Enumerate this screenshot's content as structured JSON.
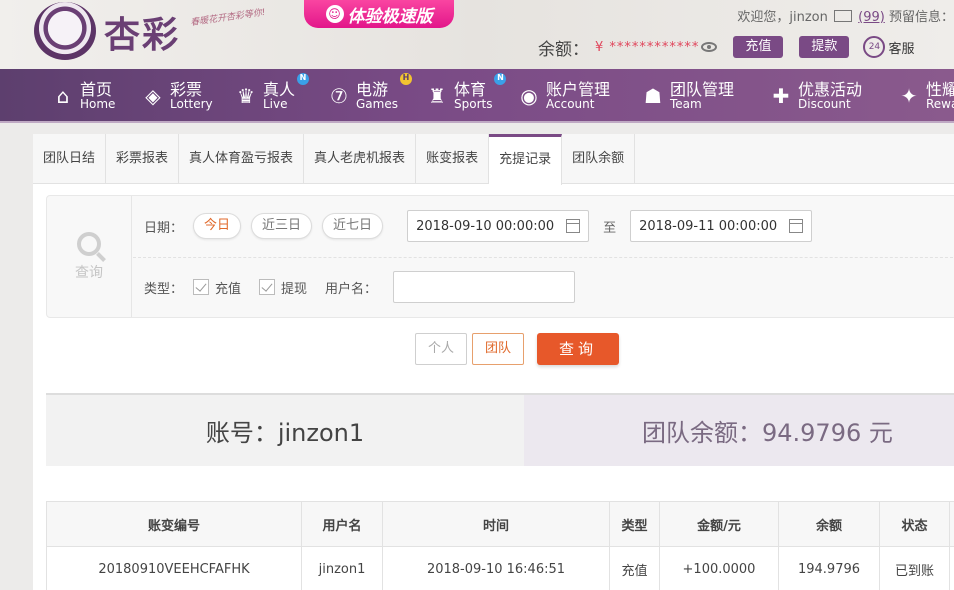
{
  "header": {
    "logo_text": "杏彩",
    "slogan": "春暖花开杏彩等你!",
    "promo_label": "体验极速版",
    "welcome_text": "欢迎您，jinzon",
    "message_count": "(99)",
    "notice_label": "预留信息：",
    "balance_label": "余额：",
    "balance_value": "¥ ************",
    "deposit_label": "充值",
    "withdraw_label": "提款",
    "service_label": "客服",
    "service_icon_text": "24"
  },
  "nav": {
    "items": [
      {
        "cn": "首页",
        "en": "Home",
        "icon": "home-icon"
      },
      {
        "cn": "彩票",
        "en": "Lottery",
        "icon": "ticket-icon"
      },
      {
        "cn": "真人",
        "en": "Live",
        "icon": "dealer-icon",
        "badge": "N"
      },
      {
        "cn": "电游",
        "en": "Games",
        "icon": "seven-icon",
        "badge": "H"
      },
      {
        "cn": "体育",
        "en": "Sports",
        "icon": "trophy-icon",
        "badge": "N"
      },
      {
        "cn": "账户管理",
        "en": "Account",
        "icon": "account-icon"
      },
      {
        "cn": "团队管理",
        "en": "Team",
        "icon": "team-icon"
      },
      {
        "cn": "优惠活动",
        "en": "Discount",
        "icon": "gift-icon"
      },
      {
        "cn": "性耀",
        "en": "Rewa",
        "icon": "reward-icon"
      }
    ]
  },
  "tabs": [
    "团队日结",
    "彩票报表",
    "真人体育盈亏报表",
    "真人老虎机报表",
    "账变报表",
    "充提记录",
    "团队余额"
  ],
  "filter": {
    "side_label": "查询",
    "date_label": "日期：",
    "quick_dates": [
      "今日",
      "近三日",
      "近七日"
    ],
    "start_date": "2018-09-10 00:00:00",
    "to_label": "至",
    "end_date": "2018-09-11 00:00:00",
    "type_label": "类型：",
    "type_deposit": "充值",
    "type_withdraw": "提现",
    "username_label": "用户名：",
    "username_value": ""
  },
  "actions": {
    "personal": "个人",
    "team": "团队",
    "query": "查询"
  },
  "summary": {
    "account": "账号：jinzon1",
    "team_balance": "团队余额：94.9796 元"
  },
  "table": {
    "headers": [
      "账变编号",
      "用户名",
      "时间",
      "类型",
      "金额/元",
      "余额",
      "状态"
    ],
    "rows": [
      [
        "20180910VEEHCFAFHK",
        "jinzon1",
        "2018-09-10 16:46:51",
        "充值",
        "+100.0000",
        "194.9796",
        "已到账"
      ]
    ]
  },
  "colors": {
    "brand_purple": "#7a4a85",
    "accent_orange": "#e7582a",
    "success_green": "#3a9a2a"
  }
}
